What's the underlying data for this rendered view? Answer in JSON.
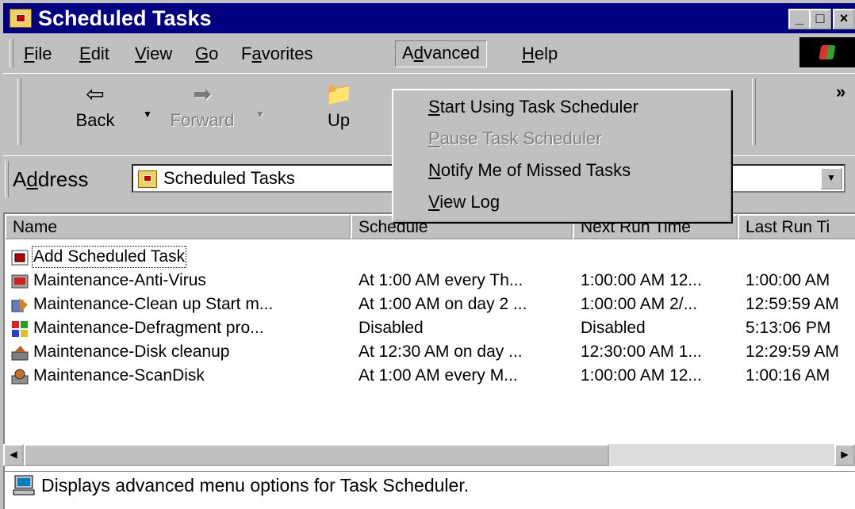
{
  "window": {
    "title": "Scheduled Tasks",
    "minimize": "_",
    "maximize": "□",
    "close": "×"
  },
  "menubar": {
    "items": [
      {
        "key": "F",
        "rest": "ile"
      },
      {
        "key": "E",
        "rest": "dit"
      },
      {
        "key": "V",
        "rest": "iew"
      },
      {
        "key": "G",
        "rest": "o"
      },
      {
        "pre": "F",
        "key": "a",
        "rest": "vorites"
      },
      {
        "pre": "A",
        "key": "d",
        "rest": "vanced"
      },
      {
        "key": "H",
        "rest": "elp"
      }
    ]
  },
  "toolbar": {
    "back_label": "Back",
    "forward_label": "Forward",
    "up_label": "Up",
    "chevron": "»"
  },
  "address": {
    "label_pre": "A",
    "label_key": "d",
    "label_rest": "dress",
    "value": "Scheduled Tasks"
  },
  "advanced_menu": {
    "items": [
      {
        "key": "S",
        "rest": "tart Using Task Scheduler",
        "enabled": true
      },
      {
        "key": "P",
        "rest": "ause Task Scheduler",
        "enabled": false
      },
      {
        "key": "N",
        "rest": "otify Me of Missed Tasks",
        "enabled": true
      },
      {
        "key": "V",
        "rest": "iew Log",
        "enabled": true
      }
    ]
  },
  "list": {
    "columns": [
      "Name",
      "Schedule",
      "Next Run Time",
      "Last Run Ti"
    ],
    "rows": [
      {
        "name": "Add Scheduled Task",
        "schedule": "",
        "next": "",
        "last": ""
      },
      {
        "name": "Maintenance-Anti-Virus",
        "schedule": "At 1:00 AM every Th...",
        "next": "1:00:00 AM  12...",
        "last": "1:00:00 AM"
      },
      {
        "name": "Maintenance-Clean up Start m...",
        "schedule": "At 1:00 AM on day 2 ...",
        "next": "1:00:00 AM  2/...",
        "last": "12:59:59 AM"
      },
      {
        "name": "Maintenance-Defragment pro...",
        "schedule": "Disabled",
        "next": "Disabled",
        "last": "5:13:06 PM"
      },
      {
        "name": "Maintenance-Disk cleanup",
        "schedule": "At 12:30 AM on day ...",
        "next": "12:30:00 AM  1...",
        "last": "12:29:59 AM"
      },
      {
        "name": "Maintenance-ScanDisk",
        "schedule": "At 1:00 AM every M...",
        "next": "1:00:00 AM  12...",
        "last": "1:00:16 AM"
      }
    ]
  },
  "status": {
    "text": "Displays advanced menu options for Task Scheduler."
  }
}
